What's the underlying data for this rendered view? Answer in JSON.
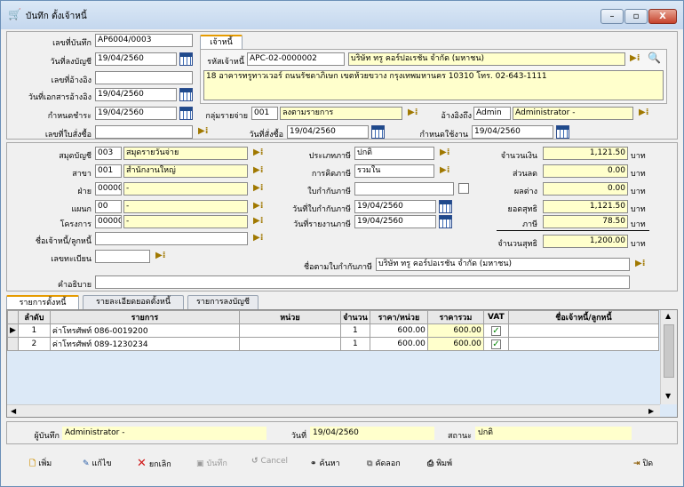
{
  "window": {
    "title": "บันทึก ตั้งเจ้าหนี้",
    "min": "–",
    "max": "▫",
    "close": "X"
  },
  "header": {
    "doc_no_label": "เลขที่บันทึก",
    "doc_no": "AP6004/0003",
    "post_date_label": "วันที่ลงบัญชี",
    "post_date": "19/04/2560",
    "ref_no_label": "เลขที่อ้างอิง",
    "ref_no": "",
    "ref_date_label": "วันที่เอกสารอ้างอิง",
    "ref_date": "19/04/2560",
    "due_label": "กำหนดชำระ",
    "due": "19/04/2560",
    "po_label": "เลขที่ใบสั่งซื้อ",
    "po": "",
    "exp_group_label": "กลุ่มรายจ่าย",
    "exp_group_code": "001",
    "exp_group_name": "ลงตามรายการ",
    "ref_by_label": "อ้างอิงถึง",
    "ref_by_code": "Admin",
    "ref_by_name": "Administrator -",
    "po_date_label": "วันที่สั่งซื้อ",
    "po_date": "19/04/2560",
    "use_date_label": "กำหนดใช้งาน",
    "use_date": "19/04/2560"
  },
  "creditor": {
    "tab": "เจ้าหนี้",
    "code_label": "รหัสเจ้าหนี้",
    "code": "APC-02-0000002",
    "name": "บริษัท ทรู คอร์ปอเรชั่น จำกัด (มหาชน)",
    "address": "18 อาคารทรูทาวเวอร์ ถนนรัชดาภิเษก  เขตห้วยขวาง กรุงเทพมหานคร 10310 โทร. 02-643-1111"
  },
  "left": {
    "book_label": "สมุดบัญชี",
    "book_code": "003",
    "book_name": "สมุดรายวันจ่าย",
    "branch_label": "สาขา",
    "branch_code": "001",
    "branch_name": "สำนักงานใหญ่",
    "div_label": "ฝ่าย",
    "div_code": "00000",
    "div_name": "-",
    "dept_label": "แผนก",
    "dept_code": "00",
    "dept_name": "-",
    "proj_label": "โครงการ",
    "proj_code": "00000",
    "proj_name": "-",
    "party_label": "ชื่อเจ้าหนี้/ลูกหนี้",
    "party": "",
    "reg_label": "เลขทะเบียน",
    "reg": ""
  },
  "mid": {
    "tax_type_label": "ประเภทภาษี",
    "tax_type": "ปกติ",
    "tax_calc_label": "การคิดภาษี",
    "tax_calc": "รวมใน",
    "inv_label": "ใบกำกับภาษี",
    "inv": "",
    "inv_date_label": "วันที่ใบกำกับภาษี",
    "inv_date": "19/04/2560",
    "report_date_label": "วันที่รายงานภาษี",
    "report_date": "19/04/2560",
    "inv_name_label": "ชื่อตามใบกำกับภาษี",
    "inv_name": "บริษัท ทรู คอร์ปอเรชั่น จำกัด (มหาชน)"
  },
  "totals": {
    "amount_label": "จำนวนเงิน",
    "amount": "1,121.50",
    "discount_label": "ส่วนลด",
    "discount": "0.00",
    "diff_label": "ผลต่าง",
    "diff": "0.00",
    "net_label": "ยอดสุทธิ",
    "net": "1,121.50",
    "tax_label": "ภาษี",
    "tax": "78.50",
    "grand_label": "จำนวนสุทธิ",
    "grand": "1,200.00",
    "unit": "บาท"
  },
  "desc_label": "คำอธิบาย",
  "desc": "",
  "tabs": [
    "รายการตั้งหนี้",
    "รายละเอียดยอดตั้งหนี้",
    "รายการลงบัญชี"
  ],
  "grid": {
    "headers": [
      "ลำดับ",
      "รายการ",
      "หน่วย",
      "จำนวน",
      "ราคา/หน่วย",
      "ราคารวม",
      "VAT",
      "ชื่อเจ้าหนี้/ลูกหนี้"
    ],
    "rows": [
      {
        "no": "1",
        "item": "ค่าโทรศัพท์ 086-0019200",
        "unit": "",
        "qty": "1",
        "price": "600.00",
        "total": "600.00",
        "vat": "✓",
        "party": ""
      },
      {
        "no": "2",
        "item": "ค่าโทรศัพท์ 089-1230234",
        "unit": "",
        "qty": "1",
        "price": "600.00",
        "total": "600.00",
        "vat": "✓",
        "party": ""
      }
    ]
  },
  "footer": {
    "recorder_label": "ผู้บันทึก",
    "recorder": "Administrator -",
    "date_label": "วันที่",
    "date": "19/04/2560",
    "status_label": "สถานะ",
    "status": "ปกติ"
  },
  "toolbar": {
    "add": "เพิ่ม",
    "edit": "แก้ไข",
    "cancel_doc": "ยกเลิก",
    "save": "บันทึก",
    "cancel": "Cancel",
    "search": "ค้นหา",
    "copy": "คัดลอก",
    "print": "พิมพ์",
    "exit": "ปิด"
  }
}
